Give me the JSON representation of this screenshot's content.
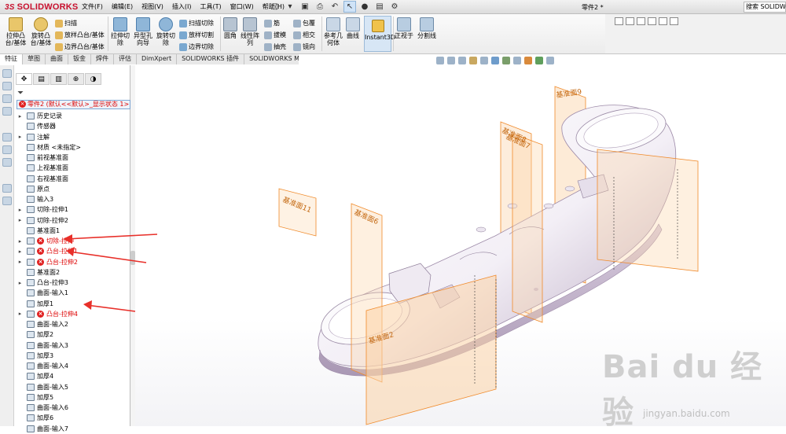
{
  "app": {
    "brand": "SOLIDWORKS",
    "doc_title": "零件2 *",
    "search_placeholder": "搜索 SOLIDWORKS"
  },
  "menu": [
    "文件(F)",
    "编辑(E)",
    "视图(V)",
    "插入(I)",
    "工具(T)",
    "窗口(W)",
    "帮助(H)"
  ],
  "ribbon": {
    "extrude_boss": "拉伸凸台/基体",
    "revolve_boss": "旋转凸台/基体",
    "sweep": "扫描",
    "loft_boss": "放样凸台/基体",
    "boundary_boss": "边界凸台/基体",
    "extrude_cut": "拉伸切除",
    "hole_wizard": "异型孔向导",
    "revolve_cut": "旋转切除",
    "swept_cut": "扫描切除",
    "lofted_cut": "放样切割",
    "boundary_cut": "边界切除",
    "fillet": "圆角",
    "linear_pattern": "线性阵列",
    "rib": "筋",
    "draft": "拔模",
    "shell": "抽壳",
    "wrap": "包覆",
    "intersect": "相交",
    "mirror": "镜向",
    "ref_geometry": "参考几何体",
    "curves": "曲线",
    "instant3d": "Instant3D",
    "normal_to": "正视于",
    "split_line": "分割线"
  },
  "tabs": [
    "特征",
    "草图",
    "曲面",
    "钣金",
    "焊件",
    "评估",
    "DimXpert",
    "SOLIDWORKS 插件",
    "SOLIDWORKS MBD"
  ],
  "tree": {
    "root": "零件2 (默认<<默认>_显示状态 1>)",
    "items": [
      {
        "label": "历史记录",
        "arrow": true,
        "error": false
      },
      {
        "label": "传感器",
        "arrow": false,
        "error": false
      },
      {
        "label": "注解",
        "arrow": true,
        "error": false
      },
      {
        "label": "材质 <未指定>",
        "arrow": false,
        "error": false
      },
      {
        "label": "前视基准面",
        "arrow": false,
        "error": false
      },
      {
        "label": "上视基准面",
        "arrow": false,
        "error": false
      },
      {
        "label": "右视基准面",
        "arrow": false,
        "error": false
      },
      {
        "label": "原点",
        "arrow": false,
        "error": false
      },
      {
        "label": "输入3",
        "arrow": false,
        "error": false
      },
      {
        "label": "切除-拉伸1",
        "arrow": true,
        "error": false
      },
      {
        "label": "切除-拉伸2",
        "arrow": true,
        "error": false
      },
      {
        "label": "基准面1",
        "arrow": false,
        "error": false
      },
      {
        "label": "切除-拉伸",
        "arrow": true,
        "error": true
      },
      {
        "label": "凸台-拉伸1",
        "arrow": true,
        "error": true
      },
      {
        "label": "凸台-拉伸2",
        "arrow": true,
        "error": true
      },
      {
        "label": "基准面2",
        "arrow": false,
        "error": false
      },
      {
        "label": "凸台-拉伸3",
        "arrow": true,
        "error": false
      },
      {
        "label": "曲面-输入1",
        "arrow": false,
        "error": false
      },
      {
        "label": "加厚1",
        "arrow": false,
        "error": false
      },
      {
        "label": "凸台-拉伸4",
        "arrow": true,
        "error": true
      },
      {
        "label": "曲面-输入2",
        "arrow": false,
        "error": false
      },
      {
        "label": "加厚2",
        "arrow": false,
        "error": false
      },
      {
        "label": "曲面-输入3",
        "arrow": false,
        "error": false
      },
      {
        "label": "加厚3",
        "arrow": false,
        "error": false
      },
      {
        "label": "曲面-输入4",
        "arrow": false,
        "error": false
      },
      {
        "label": "加厚4",
        "arrow": false,
        "error": false
      },
      {
        "label": "曲面-输入5",
        "arrow": false,
        "error": false
      },
      {
        "label": "加厚5",
        "arrow": false,
        "error": false
      },
      {
        "label": "曲面-输入6",
        "arrow": false,
        "error": false
      },
      {
        "label": "加厚6",
        "arrow": false,
        "error": false
      },
      {
        "label": "曲面-输入7",
        "arrow": false,
        "error": false
      }
    ]
  },
  "planes": {
    "p9": "基准面9",
    "p8": "基准面8",
    "p7": "基准面7",
    "p11": "基准面11",
    "p6": "基准面6",
    "p2": "基准面2"
  },
  "watermark": {
    "brand": "Bai du 经验",
    "url": "jingyan.baidu.com"
  },
  "colors": {
    "plane_fill": "#fbd3a7",
    "plane_stroke": "#f08a2a",
    "plane_text": "#c46810",
    "error_red": "#e02020",
    "arrow_red": "#e8302a",
    "instant3d_bg": "#d7e6f5"
  }
}
